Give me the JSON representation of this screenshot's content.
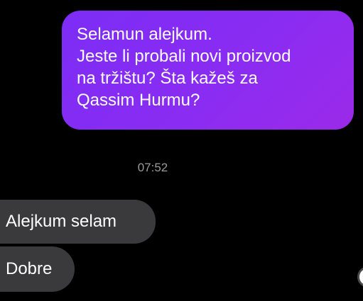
{
  "conversation": {
    "outgoing": [
      {
        "text": "Selamun alejkum.\nJeste li probali novi proizvod\nna tržištu? Šta kažeš za\nQassim Hurmu?"
      }
    ],
    "timestamp": "07:52",
    "incoming": [
      {
        "text": "Alejkum selam"
      },
      {
        "text": "Dobre"
      }
    ]
  },
  "colors": {
    "background": "#000000",
    "outgoing_bubble_start": "#7c2df6",
    "outgoing_bubble_end": "#9b2ae9",
    "incoming_bubble": "#3a3a3c",
    "timestamp_text": "#9b9b9b"
  }
}
